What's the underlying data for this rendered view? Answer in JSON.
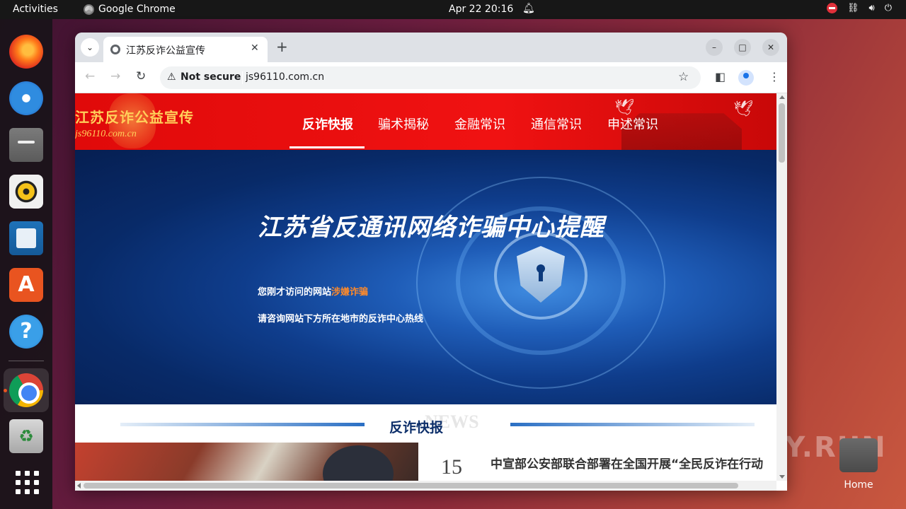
{
  "topbar": {
    "activities": "Activities",
    "app_name": "Google Chrome",
    "datetime": "Apr 22  20:16",
    "bell_icon": "bell-icon",
    "tray_icons": [
      "do-not-disturb-icon",
      "network-icon",
      "volume-icon",
      "power-icon"
    ]
  },
  "dock": {
    "apps": [
      "Firefox",
      "Thunderbird",
      "Files",
      "Rhythmbox",
      "LibreOffice Writer",
      "Ubuntu Software",
      "Help",
      "Google Chrome",
      "Trash",
      "Show Applications"
    ]
  },
  "desktop": {
    "home_label": "Home",
    "watermark": "ANY.RUN"
  },
  "browser": {
    "tab_title": "江苏反诈公益宣传",
    "tab_close": "✕",
    "new_tab": "+",
    "security_label": "Not secure",
    "url": "js96110.com.cn",
    "window_controls": [
      "–",
      "□",
      "✕"
    ]
  },
  "page": {
    "logo_title": "江苏反诈公益宣传",
    "logo_url": "js96110.com.cn",
    "nav": [
      {
        "label": "反诈快报",
        "active": true
      },
      {
        "label": "骗术揭秘",
        "active": false
      },
      {
        "label": "金融常识",
        "active": false
      },
      {
        "label": "通信常识",
        "active": false
      },
      {
        "label": "申述常识",
        "active": false
      }
    ],
    "banner": {
      "title": "江苏省反通讯网络诈骗中心提醒",
      "line1_prefix": "您刚才访问的网站",
      "line1_highlight": "涉嫌诈骗",
      "line2": "请咨询网站下方所在地市的反诈中心热线"
    },
    "section": {
      "title": "反诈快报",
      "ghost": "NEWS"
    },
    "news": [
      {
        "date": "15",
        "title": "中宣部公安部联合部署在全国开展“全民反诈在行动"
      }
    ]
  },
  "colors": {
    "header_red": "#e00a0a",
    "banner_blue": "#0f3d8c",
    "logo_gold": "#ffcf5a",
    "highlight_orange": "#ff8a2a",
    "section_title": "#0d2f6a",
    "ubuntu_orange": "#e95420"
  }
}
